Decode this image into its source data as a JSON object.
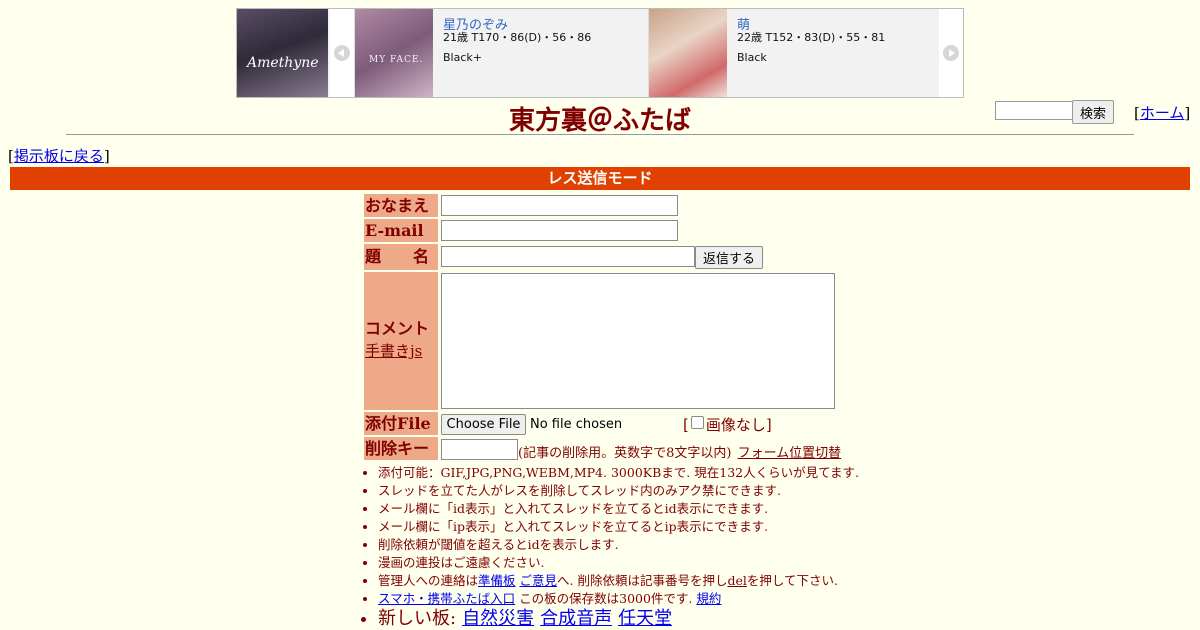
{
  "banner": {
    "left_image_text": "Amethyne",
    "card1": {
      "name": "星乃のぞみ",
      "spec": "21歳 T170・86(D)・56・86",
      "rank": "Black+",
      "thumb_text": "MY FACE."
    },
    "card2": {
      "name": "萌",
      "spec": "22歳 T152・83(D)・55・81",
      "rank": "Black"
    }
  },
  "header": {
    "title": "東方裏＠ふたば",
    "search_button": "検索",
    "home_link": "ホーム",
    "bracket_open": "[",
    "bracket_close": "]"
  },
  "back_link": "掲示板に戻る",
  "mode_bar": "レス送信モード",
  "form": {
    "name_label": "おなまえ",
    "email_label": "E-mail",
    "subject_label": "題　　名",
    "submit_button": "返信する",
    "comment_label": "コメント",
    "draw_link": "手書きjs",
    "file_label": "添付File",
    "file_button": "Choose File",
    "file_status": "No file chosen",
    "noimg_label": "画像なし",
    "delkey_label": "削除キー",
    "delkey_note": "(記事の削除用。英数字で8文字以内)",
    "form_switch": "フォーム位置切替"
  },
  "notes": {
    "n1": "添付可能：GIF,JPG,PNG,WEBM,MP4. 3000KBまで. 現在132人くらいが見てます.",
    "n2": "スレッドを立てた人がレスを削除してスレッド内のみアク禁にできます.",
    "n3": "メール欄に「id表示」と入れてスレッドを立てるとid表示にできます.",
    "n4": "メール欄に「ip表示」と入れてスレッドを立てるとip表示にできます.",
    "n5": "削除依頼が閾値を超えるとidを表示します.",
    "n6": "漫画の連投はご遠慮ください.",
    "n7_pre": "管理人への連絡は",
    "n7_link1": "準備板",
    "n7_link2": "ご意見",
    "n7_mid": "へ. 削除依頼は記事番号を押し",
    "n7_del": "del",
    "n7_post": "を押して下さい.",
    "n8_link": "スマホ・携帯ふたば入口",
    "n8_mid": " この板の保存数は3000件です.",
    "n8_rules": "規約",
    "n9_label": "新しい板:",
    "n9_links": [
      "自然災害",
      "合成音声",
      "任天堂"
    ]
  }
}
